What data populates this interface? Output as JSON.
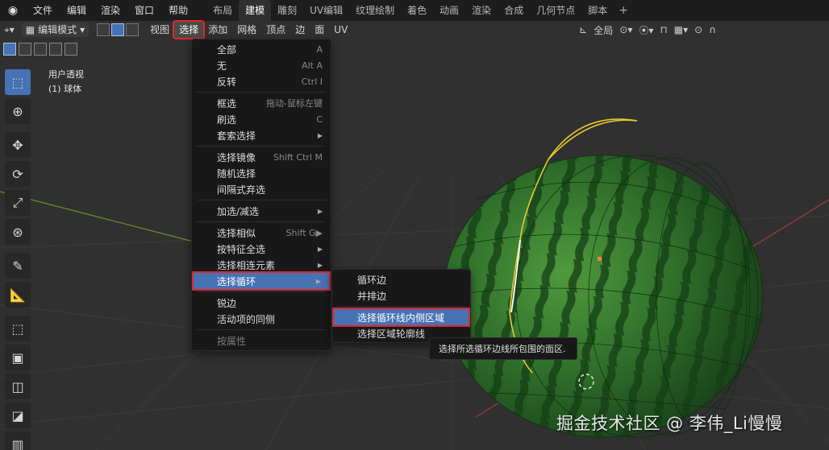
{
  "topbar": {
    "menus": [
      "文件",
      "编辑",
      "渲染",
      "窗口",
      "帮助"
    ],
    "workspaces": [
      "布局",
      "建模",
      "雕刻",
      "UV编辑",
      "纹理绘制",
      "着色",
      "动画",
      "渲染",
      "合成",
      "几何节点",
      "脚本"
    ],
    "active_workspace_index": 1,
    "add_label": "+"
  },
  "header": {
    "mode_label": "编辑模式",
    "menus": [
      "视图",
      "选择",
      "添加",
      "网格",
      "顶点",
      "边",
      "面",
      "UV"
    ],
    "active_menu": "选择",
    "transform_orientation": "全局"
  },
  "viewport": {
    "view_name": "用户透视",
    "object_name": "(1) 球体"
  },
  "select_menu": {
    "items": [
      {
        "label": "全部",
        "shortcut": "A"
      },
      {
        "label": "无",
        "shortcut": "Alt A"
      },
      {
        "label": "反转",
        "shortcut": "Ctrl I"
      },
      {
        "label": "框选",
        "shortcut": "拖动-鼠标左键"
      },
      {
        "label": "刷选",
        "shortcut": "C"
      },
      {
        "label": "套索选择",
        "shortcut": "▶"
      },
      {
        "label": "选择镜像",
        "shortcut": "Shift Ctrl M"
      },
      {
        "label": "随机选择",
        "shortcut": ""
      },
      {
        "label": "间隔式弃选",
        "shortcut": ""
      },
      {
        "label": "加选/减选",
        "shortcut": "▶"
      },
      {
        "label": "选择相似",
        "shortcut": "Shift G▶"
      },
      {
        "label": "按特征全选",
        "shortcut": "▶"
      },
      {
        "label": "选择相连元素",
        "shortcut": "▶"
      },
      {
        "label": "选择循环",
        "shortcut": "▶"
      },
      {
        "label": "锐边",
        "shortcut": ""
      },
      {
        "label": "活动项的同侧",
        "shortcut": ""
      },
      {
        "label": "按属性",
        "shortcut": ""
      }
    ]
  },
  "loop_submenu": {
    "items": [
      {
        "label": "循环边"
      },
      {
        "label": "并排边"
      },
      {
        "label": "选择循环线内侧区域"
      },
      {
        "label": "选择区域轮廓线"
      }
    ]
  },
  "tooltip": {
    "text": "选择所选循环边线所包围的面区."
  },
  "watermark": {
    "text": "掘金技术社区 @ 李伟_Li慢慢"
  },
  "colors": {
    "accent": "#4772b3",
    "highlight_outline": "#e0262b",
    "menu_bg": "#181818",
    "watermelon_dark": "#1f4d1f",
    "watermelon_light": "#3f8f34"
  }
}
